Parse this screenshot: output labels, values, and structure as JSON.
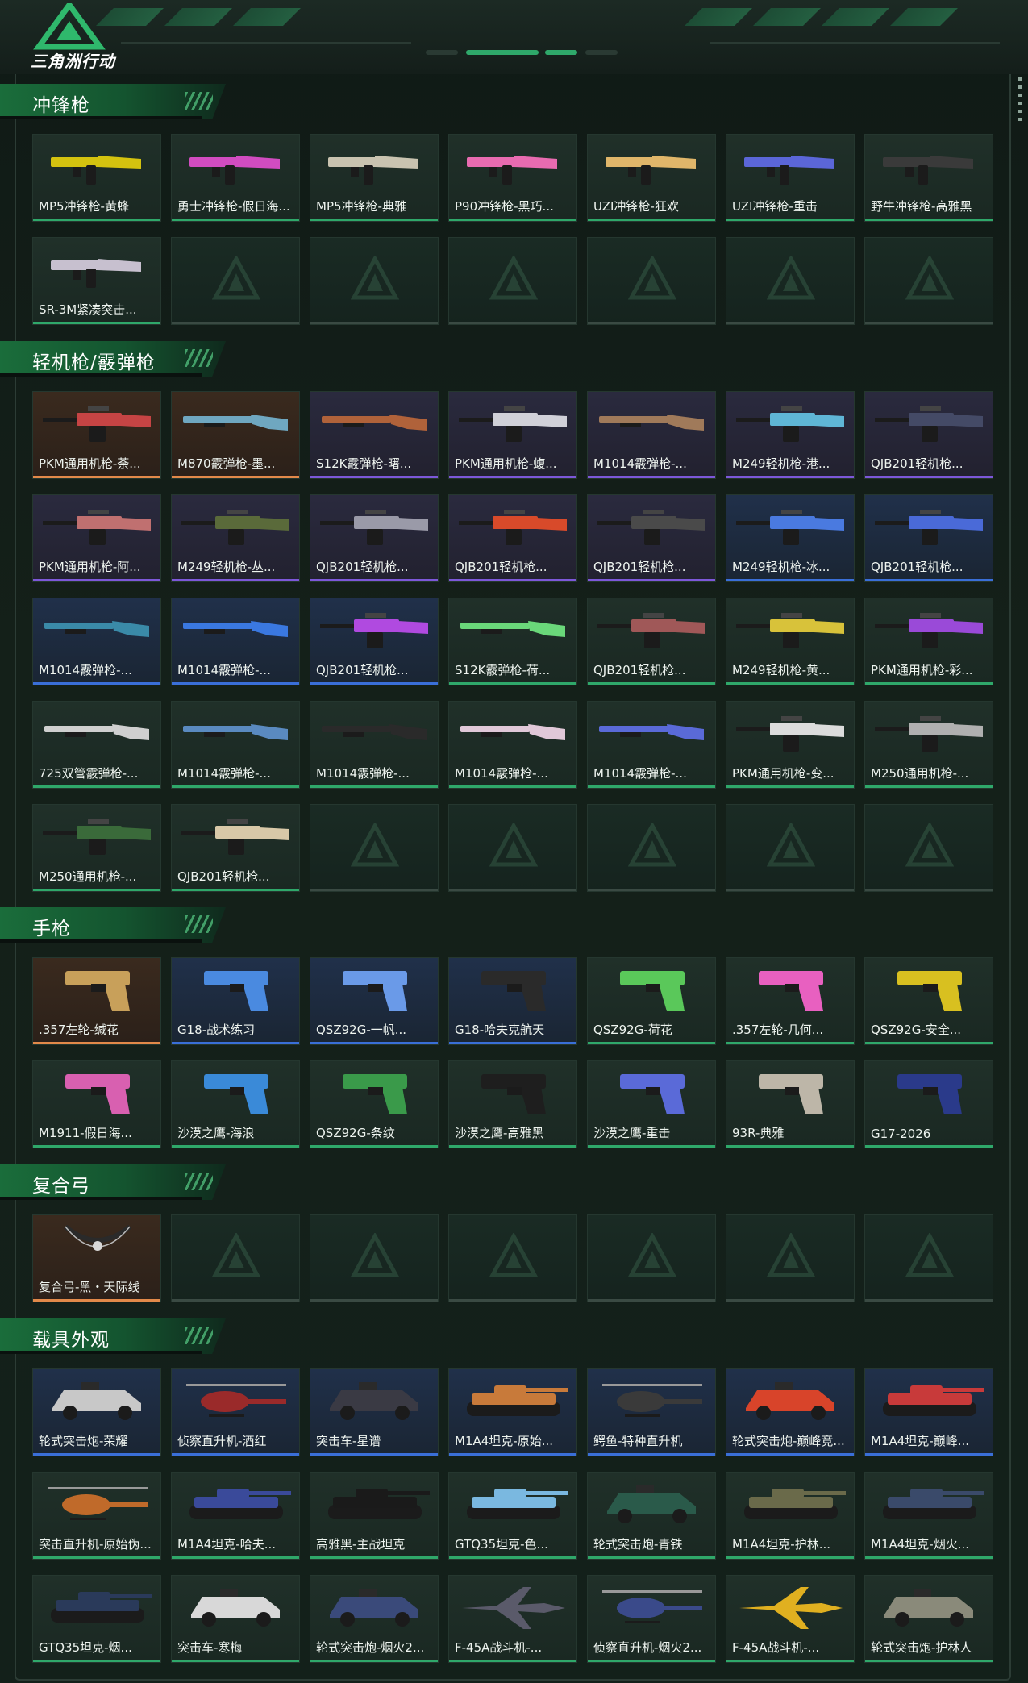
{
  "header": {
    "logo_text": "三角洲行动"
  },
  "colors": {
    "accent": "#2fa86a",
    "gold": "#e2894a",
    "purple": "#7d58d9",
    "blue": "#3a6fd8"
  },
  "sections": [
    {
      "title": "冲锋枪",
      "items": [
        {
          "name": "MP5冲锋枪-黄蜂",
          "q": "green",
          "icon": "smg-icon",
          "c": "#d4c20f"
        },
        {
          "name": "勇士冲锋枪-假日海...",
          "q": "green",
          "icon": "smg-icon",
          "c": "#d14cc0"
        },
        {
          "name": "MP5冲锋枪-典雅",
          "q": "green",
          "icon": "smg-icon",
          "c": "#c9c3b0"
        },
        {
          "name": "P90冲锋枪-黑巧...",
          "q": "green",
          "icon": "smg-icon",
          "c": "#e86bb0"
        },
        {
          "name": "UZI冲锋枪-狂欢",
          "q": "green",
          "icon": "smg-icon",
          "c": "#e0b66a"
        },
        {
          "name": "UZI冲锋枪-重击",
          "q": "green",
          "icon": "smg-icon",
          "c": "#5b66d8"
        },
        {
          "name": "野牛冲锋枪-高雅黑",
          "q": "green",
          "icon": "smg-icon",
          "c": "#3a3a3a"
        },
        {
          "name": "SR-3M紧凑突击...",
          "q": "green",
          "icon": "smg-icon",
          "c": "#c7c0cf"
        }
      ],
      "slots": 14
    },
    {
      "title": "轻机枪/霰弹枪",
      "items": [
        {
          "name": "PKM通用机枪-荼...",
          "q": "gold",
          "icon": "lmg-icon",
          "c": "#c64444"
        },
        {
          "name": "M870霰弹枪-墨...",
          "q": "gold",
          "icon": "shotgun-icon",
          "c": "#6fa7c0"
        },
        {
          "name": "S12K霰弹枪-曙...",
          "q": "purple",
          "icon": "shotgun-icon",
          "c": "#b0623a"
        },
        {
          "name": "PKM通用机枪-蝮...",
          "q": "purple",
          "icon": "lmg-icon",
          "c": "#d0d0d8"
        },
        {
          "name": "M1014霰弹枪-...",
          "q": "purple",
          "icon": "shotgun-icon",
          "c": "#a07a5a"
        },
        {
          "name": "M249轻机枪-港...",
          "q": "purple",
          "icon": "lmg-icon",
          "c": "#5fb6d6"
        },
        {
          "name": "QJB201轻机枪...",
          "q": "purple",
          "icon": "lmg-icon",
          "c": "#444a66"
        },
        {
          "name": "PKM通用机枪-阿...",
          "q": "purple",
          "icon": "lmg-icon",
          "c": "#c07070"
        },
        {
          "name": "M249轻机枪-丛...",
          "q": "purple",
          "icon": "lmg-icon",
          "c": "#5a6a3a"
        },
        {
          "name": "QJB201轻机枪...",
          "q": "purple",
          "icon": "lmg-icon",
          "c": "#9a9aa8"
        },
        {
          "name": "QJB201轻机枪...",
          "q": "purple",
          "icon": "lmg-icon",
          "c": "#d84a2a"
        },
        {
          "name": "QJB201轻机枪...",
          "q": "purple",
          "icon": "lmg-icon",
          "c": "#4a4a4a"
        },
        {
          "name": "M249轻机枪-冰...",
          "q": "blue",
          "icon": "lmg-icon",
          "c": "#4a7ae0"
        },
        {
          "name": "QJB201轻机枪...",
          "q": "blue",
          "icon": "lmg-icon",
          "c": "#4a6ad8"
        },
        {
          "name": "M1014霰弹枪-...",
          "q": "blue",
          "icon": "shotgun-icon",
          "c": "#3a8aa8"
        },
        {
          "name": "M1014霰弹枪-...",
          "q": "blue",
          "icon": "shotgun-icon",
          "c": "#3a78e0"
        },
        {
          "name": "QJB201轻机枪...",
          "q": "blue",
          "icon": "lmg-icon",
          "c": "#b04ae0"
        },
        {
          "name": "S12K霰弹枪-荷...",
          "q": "green",
          "icon": "shotgun-icon",
          "c": "#6ad87a"
        },
        {
          "name": "QJB201轻机枪...",
          "q": "green",
          "icon": "lmg-icon",
          "c": "#a05858"
        },
        {
          "name": "M249轻机枪-黄...",
          "q": "green",
          "icon": "lmg-icon",
          "c": "#d8c23a"
        },
        {
          "name": "PKM通用机枪-彩...",
          "q": "green",
          "icon": "lmg-icon",
          "c": "#9a4ad8"
        },
        {
          "name": "725双管霰弹枪-...",
          "q": "green",
          "icon": "shotgun-icon",
          "c": "#cfcfcf"
        },
        {
          "name": "M1014霰弹枪-...",
          "q": "green",
          "icon": "shotgun-icon",
          "c": "#5a8ac0"
        },
        {
          "name": "M1014霰弹枪-...",
          "q": "green",
          "icon": "shotgun-icon",
          "c": "#2a2a2a"
        },
        {
          "name": "M1014霰弹枪-...",
          "q": "green",
          "icon": "shotgun-icon",
          "c": "#e0c8d8"
        },
        {
          "name": "M1014霰弹枪-...",
          "q": "green",
          "icon": "shotgun-icon",
          "c": "#5a6ad8"
        },
        {
          "name": "PKM通用机枪-变...",
          "q": "green",
          "icon": "lmg-icon",
          "c": "#dcdcdc"
        },
        {
          "name": "M250通用机枪-...",
          "q": "green",
          "icon": "lmg-icon",
          "c": "#b0b0b0"
        },
        {
          "name": "M250通用机枪-...",
          "q": "green",
          "icon": "lmg-icon",
          "c": "#3a6a3a"
        },
        {
          "name": "QJB201轻机枪...",
          "q": "green",
          "icon": "lmg-icon",
          "c": "#d8c8a8"
        }
      ],
      "slots": 35
    },
    {
      "title": "手枪",
      "items": [
        {
          "name": ".357左轮-缄花",
          "q": "gold",
          "icon": "pistol-icon",
          "c": "#c8a05a"
        },
        {
          "name": "G18-战术练习",
          "q": "blue",
          "icon": "pistol-icon",
          "c": "#4a8ae0"
        },
        {
          "name": "QSZ92G-一帆...",
          "q": "blue",
          "icon": "pistol-icon",
          "c": "#6a9ae8"
        },
        {
          "name": "G18-哈夫克航天",
          "q": "blue",
          "icon": "pistol-icon",
          "c": "#2a2a2a"
        },
        {
          "name": "QSZ92G-荷花",
          "q": "green",
          "icon": "pistol-icon",
          "c": "#5ac85a"
        },
        {
          "name": ".357左轮-几何...",
          "q": "green",
          "icon": "pistol-icon",
          "c": "#e860c0"
        },
        {
          "name": "QSZ92G-安全...",
          "q": "green",
          "icon": "pistol-icon",
          "c": "#d8c020"
        },
        {
          "name": "M1911-假日海...",
          "q": "green",
          "icon": "pistol-icon",
          "c": "#d860b0"
        },
        {
          "name": "沙漠之鹰-海浪",
          "q": "green",
          "icon": "pistol-icon",
          "c": "#3a8ad8"
        },
        {
          "name": "QSZ92G-条纹",
          "q": "green",
          "icon": "pistol-icon",
          "c": "#3a9a4a"
        },
        {
          "name": "沙漠之鹰-高雅黑",
          "q": "green",
          "icon": "pistol-icon",
          "c": "#1e1e1e"
        },
        {
          "name": "沙漠之鹰-重击",
          "q": "green",
          "icon": "pistol-icon",
          "c": "#5a6ad8"
        },
        {
          "name": "93R-典雅",
          "q": "green",
          "icon": "pistol-icon",
          "c": "#bdb6a8"
        },
        {
          "name": "G17-2026",
          "q": "green",
          "icon": "pistol-icon",
          "c": "#2a3a8a"
        }
      ],
      "slots": 14
    },
    {
      "title": "复合弓",
      "items": [
        {
          "name": "复合弓-黑・天际线",
          "q": "gold",
          "icon": "bow-icon",
          "c": "#2a2a2a"
        }
      ],
      "slots": 7
    },
    {
      "title": "载具外观",
      "items": [
        {
          "name": "轮式突击炮-荣耀",
          "q": "blue",
          "icon": "vehicle-icon",
          "c": "#c8c8c8"
        },
        {
          "name": "侦察直升机-酒红",
          "q": "blue",
          "icon": "helicopter-icon",
          "c": "#9a2a2a"
        },
        {
          "name": "突击车-星谱",
          "q": "blue",
          "icon": "vehicle-icon",
          "c": "#3a3a44"
        },
        {
          "name": "M1A4坦克-原始...",
          "q": "blue",
          "icon": "tank-icon",
          "c": "#c87a3a"
        },
        {
          "name": "鳄鱼-特种直升机",
          "q": "blue",
          "icon": "helicopter-icon",
          "c": "#3a3a3a"
        },
        {
          "name": "轮式突击炮-巅峰竞...",
          "q": "blue",
          "icon": "vehicle-icon",
          "c": "#d8442a"
        },
        {
          "name": "M1A4坦克-巅峰...",
          "q": "blue",
          "icon": "tank-icon",
          "c": "#c83a3a"
        },
        {
          "name": "突击直升机-原始伪...",
          "q": "green",
          "icon": "helicopter-icon",
          "c": "#c06a2a"
        },
        {
          "name": "M1A4坦克-哈夫...",
          "q": "green",
          "icon": "tank-icon",
          "c": "#3a4a9a"
        },
        {
          "name": "高雅黑-主战坦克",
          "q": "green",
          "icon": "tank-icon",
          "c": "#1a1a1a"
        },
        {
          "name": "GTQ35坦克-色...",
          "q": "green",
          "icon": "tank-icon",
          "c": "#7ab8e0"
        },
        {
          "name": "轮式突击炮-青铁",
          "q": "green",
          "icon": "vehicle-icon",
          "c": "#2a5a4a"
        },
        {
          "name": "M1A4坦克-护林...",
          "q": "green",
          "icon": "tank-icon",
          "c": "#6a6a4a"
        },
        {
          "name": "M1A4坦克-烟火...",
          "q": "green",
          "icon": "tank-icon",
          "c": "#3a4a6a"
        },
        {
          "name": "GTQ35坦克-烟...",
          "q": "green",
          "icon": "tank-icon",
          "c": "#2a3a5a"
        },
        {
          "name": "突击车-寒梅",
          "q": "green",
          "icon": "vehicle-icon",
          "c": "#d8d8d8"
        },
        {
          "name": "轮式突击炮-烟火2...",
          "q": "green",
          "icon": "vehicle-icon",
          "c": "#3a4a7a"
        },
        {
          "name": "F-45A战斗机-...",
          "q": "green",
          "icon": "jet-icon",
          "c": "#5a5a6a"
        },
        {
          "name": "侦察直升机-烟火2...",
          "q": "green",
          "icon": "helicopter-icon",
          "c": "#3a4a8a"
        },
        {
          "name": "F-45A战斗机-...",
          "q": "green",
          "icon": "jet-icon",
          "c": "#e0b020"
        },
        {
          "name": "轮式突击炮-护林人",
          "q": "green",
          "icon": "vehicle-icon",
          "c": "#8a8a7a"
        }
      ],
      "slots": 21
    }
  ]
}
